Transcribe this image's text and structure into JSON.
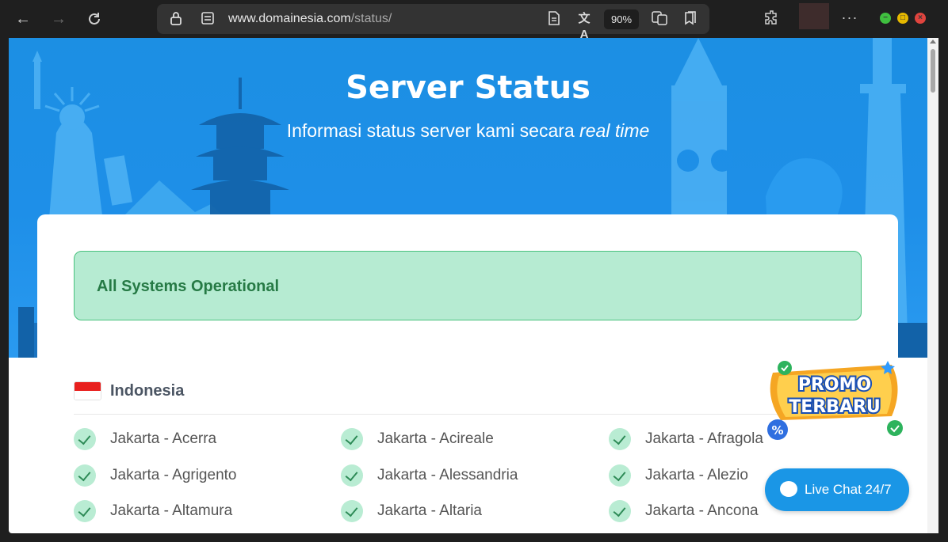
{
  "browser": {
    "back_icon": "arrow-left-icon",
    "forward_icon": "arrow-right-icon",
    "reload_icon": "reload-icon",
    "url_host": "www.domainesia.com",
    "url_path": "/status/",
    "zoom": "90%"
  },
  "hero": {
    "title": "Server Status",
    "subtitle_plain": "Informasi status server kami secara ",
    "subtitle_italic": "real time"
  },
  "status": {
    "message": "All Systems Operational",
    "color": "#267a45",
    "background": "#b6ebd2"
  },
  "region": {
    "name": "Indonesia",
    "flag": "indonesia-flag"
  },
  "servers": [
    {
      "name": "Jakarta - Acerra",
      "status": "ok"
    },
    {
      "name": "Jakarta - Acireale",
      "status": "ok"
    },
    {
      "name": "Jakarta - Afragola",
      "status": "ok"
    },
    {
      "name": "Jakarta - Agrigento",
      "status": "ok"
    },
    {
      "name": "Jakarta - Alessandria",
      "status": "ok"
    },
    {
      "name": "Jakarta - Alezio",
      "status": "ok"
    },
    {
      "name": "Jakarta - Altamura",
      "status": "ok"
    },
    {
      "name": "Jakarta - Altaria",
      "status": "ok"
    },
    {
      "name": "Jakarta - Ancona",
      "status": "ok"
    }
  ],
  "promo": {
    "line1": "PROMO",
    "line2": "TERBARU"
  },
  "chat": {
    "label": "Live Chat 24/7"
  },
  "colors": {
    "accent": "#1a96e6",
    "ok_green": "#2e8b57"
  }
}
